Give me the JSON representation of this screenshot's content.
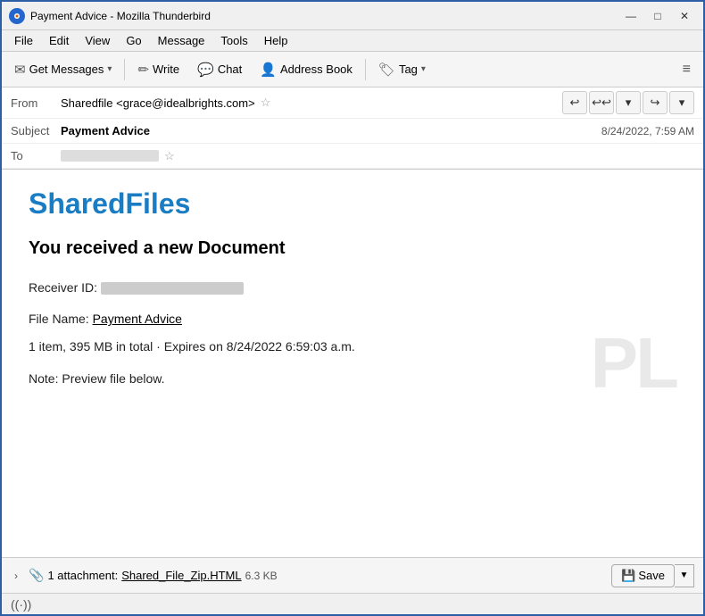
{
  "window": {
    "title": "Payment Advice - Mozilla Thunderbird",
    "icon": "thunderbird-icon"
  },
  "title_controls": {
    "minimize": "—",
    "maximize": "□",
    "close": "✕"
  },
  "menu": {
    "items": [
      "File",
      "Edit",
      "View",
      "Go",
      "Message",
      "Tools",
      "Help"
    ]
  },
  "toolbar": {
    "get_messages_label": "Get Messages",
    "write_label": "Write",
    "chat_label": "Chat",
    "address_book_label": "Address Book",
    "tag_label": "Tag",
    "hamburger": "≡"
  },
  "email_header": {
    "from_label": "From",
    "from_value": "Sharedfile <grace@idealbrights.com>",
    "subject_label": "Subject",
    "subject_value": "Payment Advice",
    "date_value": "8/24/2022, 7:59 AM",
    "to_label": "To"
  },
  "email_body": {
    "brand_title": "SharedFiles",
    "doc_heading": "You received a new Document",
    "receiver_label": "Receiver ID:",
    "filename_label": "File Name:",
    "filename_link": "Payment Advice",
    "item_info": "1 item, 395 MB in total  ·  Expires on 8/24/2022 6:59:03 a.m.",
    "note": "Note: Preview file below."
  },
  "attachment": {
    "expand_arrow": "›",
    "count_label": "1 attachment:",
    "filename": "Shared_File_Zip.HTML",
    "size": "6.3 KB",
    "save_label": "Save",
    "save_arrow": "▼"
  },
  "status_bar": {
    "icon": "((·))"
  }
}
